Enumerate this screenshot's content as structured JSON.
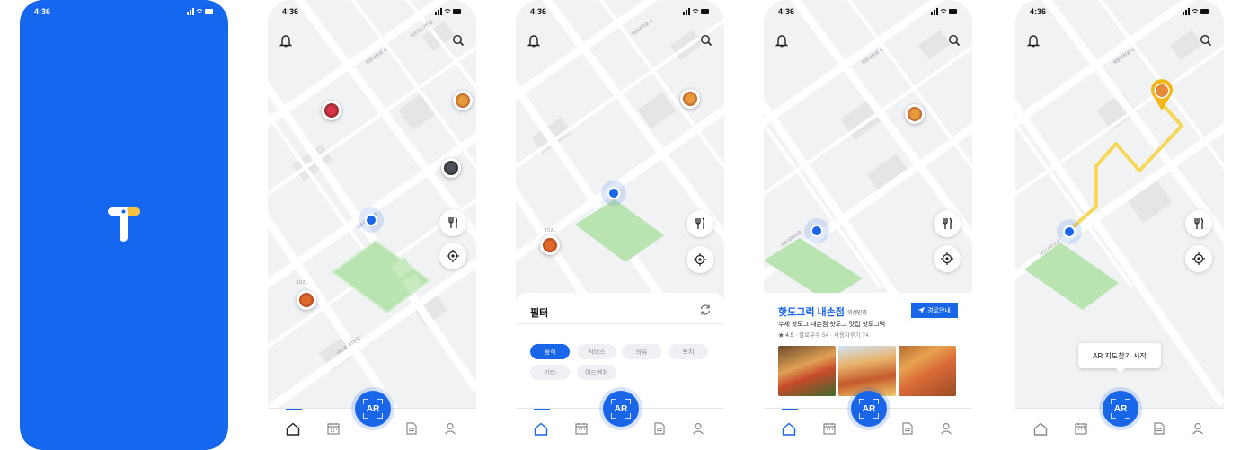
{
  "status": {
    "time": "4:36"
  },
  "splash": {
    "logo_letter": "T",
    "bg_color": "#1667f0"
  },
  "ar_button": {
    "label": "AR"
  },
  "map_labels": {
    "street_a": "내손로57번길",
    "street_b": "계원대학로 4",
    "street_c": "내손로 8",
    "street_d": "내손대복회로",
    "street_e": "102L",
    "street_f": "게원대학로",
    "street_g": "내손로 43번길"
  },
  "filter": {
    "title": "필터",
    "chips": [
      "음식",
      "서비스",
      "의류",
      "복지",
      "기타",
      "어드벤처"
    ],
    "active": "음식"
  },
  "place": {
    "name": "핫도그럭 내손점",
    "badge": "위생인증",
    "description": "수제 핫도그 내손점 핫도그 맛집 핫도그럭",
    "rating": "★ 4.5",
    "meta": " · 팔로우수 54 · 사용자후기 74",
    "route_button": "경로안내"
  },
  "ar_tooltip": {
    "label": "AR 지도찾기 시작"
  },
  "colors": {
    "accent": "#1a66e8",
    "park": "#b9e3b0",
    "route": "#f5d85a",
    "pin": "#f2b619"
  },
  "icons": [
    "bell-icon",
    "search-icon",
    "restaurant-filter-icon",
    "locate-icon",
    "home-icon",
    "calendar-icon",
    "document-icon",
    "profile-icon",
    "refresh-icon",
    "navigation-arrow-icon"
  ]
}
